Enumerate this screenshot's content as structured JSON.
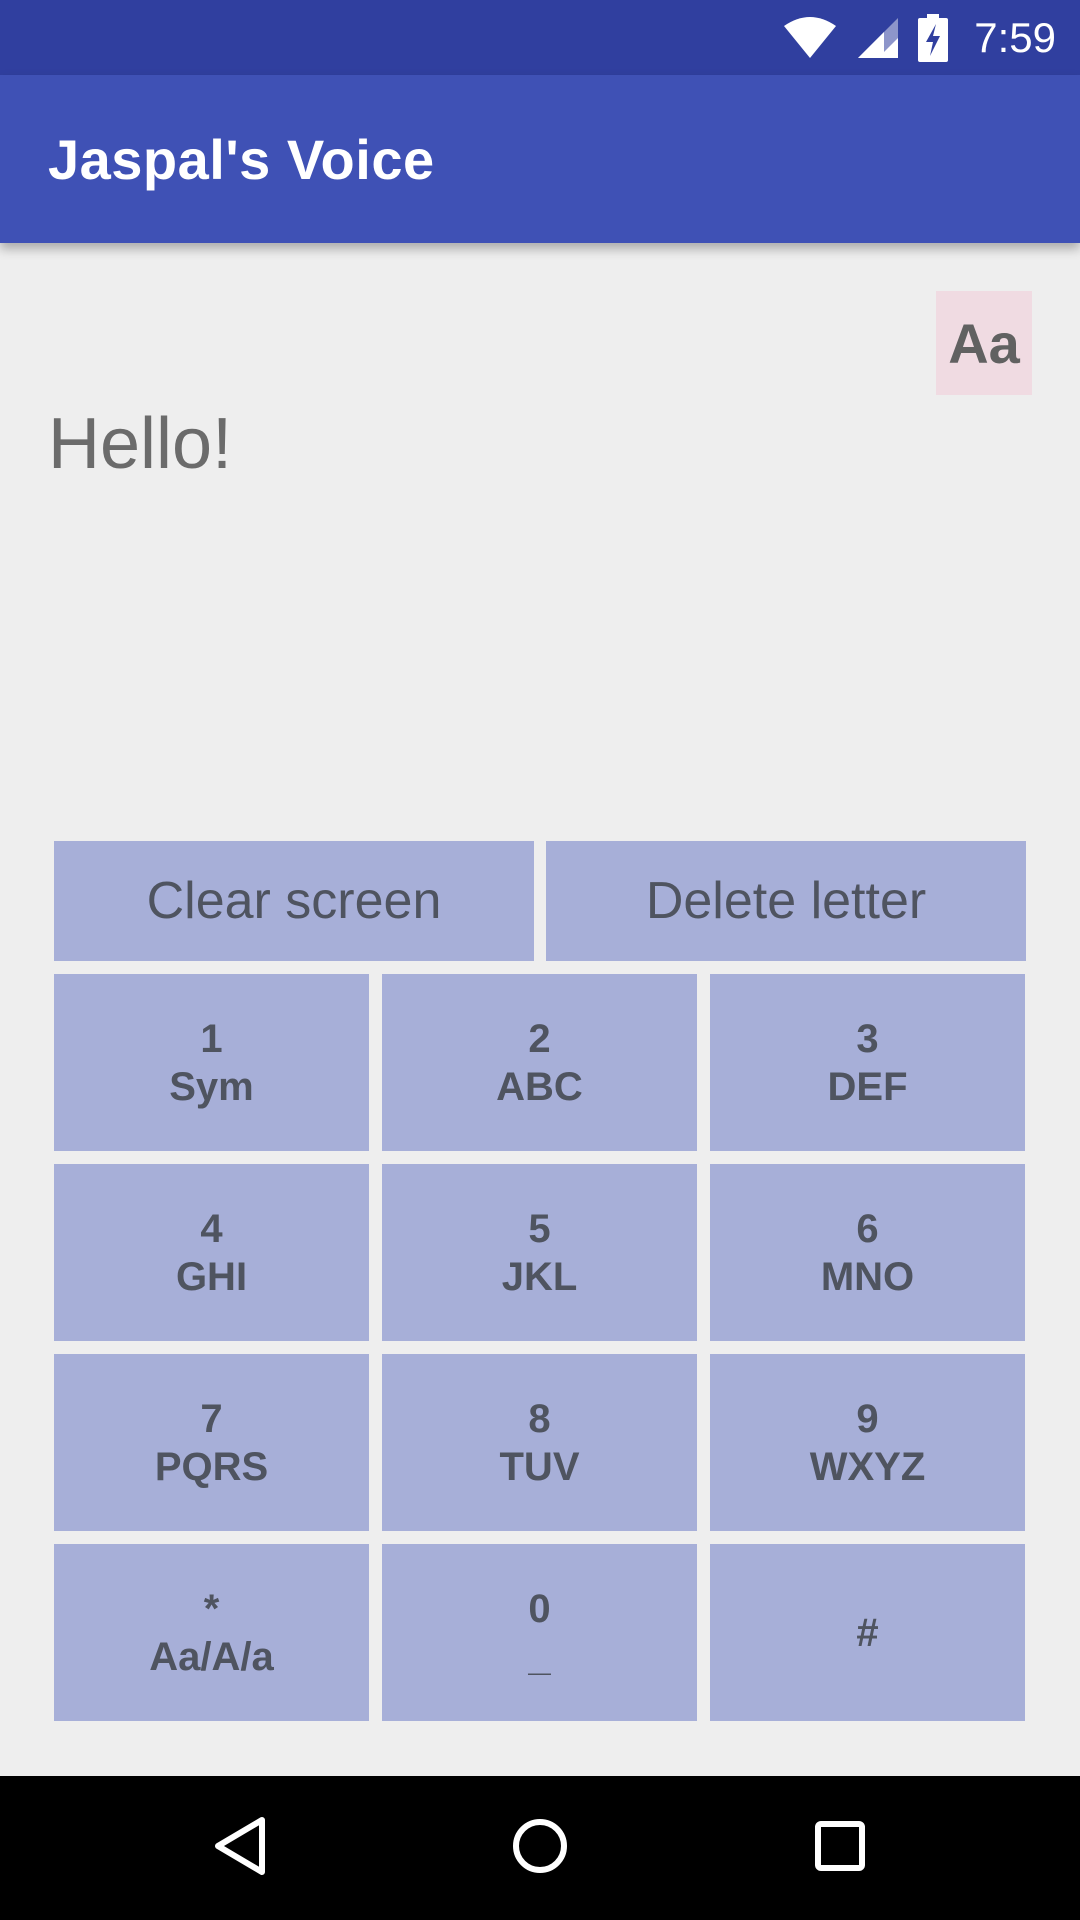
{
  "status_bar": {
    "time": "7:59",
    "icons": [
      "wifi-icon",
      "cell-signal-icon",
      "battery-charging-icon"
    ]
  },
  "app_bar": {
    "title": "Jaspal's Voice",
    "color": "#3f51b5"
  },
  "toolbar": {
    "font_toggle_label": "Aa"
  },
  "output": {
    "text": "Hello!"
  },
  "actions": {
    "clear_label": "Clear screen",
    "delete_label": "Delete letter"
  },
  "keypad": {
    "keys": [
      {
        "line1": "1",
        "line2": "Sym"
      },
      {
        "line1": "2",
        "line2": "ABC"
      },
      {
        "line1": "3",
        "line2": "DEF"
      },
      {
        "line1": "4",
        "line2": "GHI"
      },
      {
        "line1": "5",
        "line2": "JKL"
      },
      {
        "line1": "6",
        "line2": "MNO"
      },
      {
        "line1": "7",
        "line2": "PQRS"
      },
      {
        "line1": "8",
        "line2": "TUV"
      },
      {
        "line1": "9",
        "line2": "WXYZ"
      },
      {
        "line1": "*",
        "line2": "Aa/A/a"
      },
      {
        "line1": "0",
        "line2": "_"
      },
      {
        "line1": "#",
        "line2": ""
      }
    ],
    "button_color": "#a7afd8"
  },
  "nav_bar": {
    "icons": [
      "back-icon",
      "home-icon",
      "recents-icon"
    ]
  }
}
